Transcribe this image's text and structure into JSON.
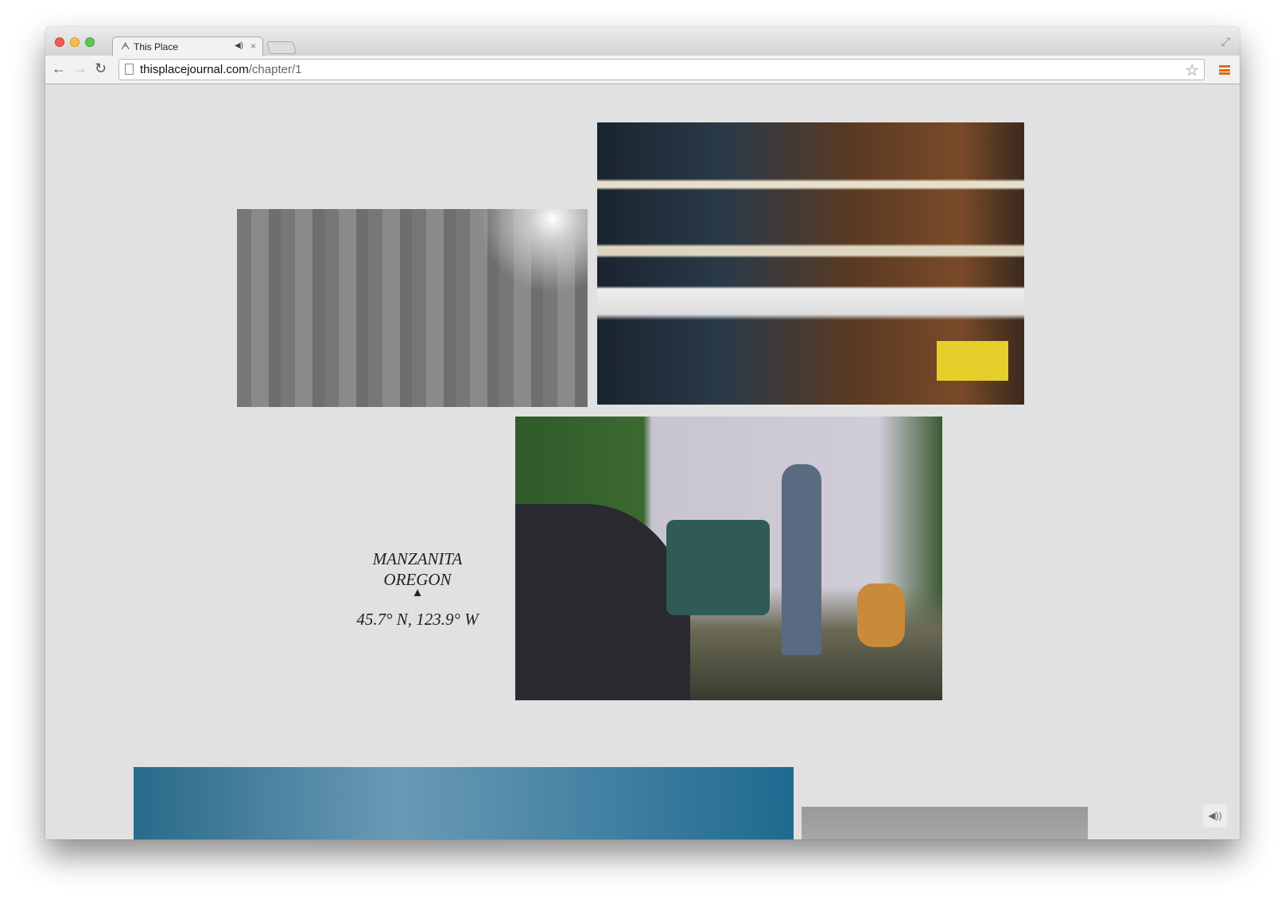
{
  "browser": {
    "tab_title": "This Place",
    "tab_icon": "this-place-logo",
    "url_domain": "thisplacejournal.com",
    "url_path": "/chapter/1",
    "accent_color": "#e06a10"
  },
  "page": {
    "location": {
      "line1": "MANZANITA",
      "line2": "OREGON",
      "marker": "▲",
      "coordinates": "45.7° N, 123.9° W"
    },
    "sound_icon": "speaker-icon"
  }
}
